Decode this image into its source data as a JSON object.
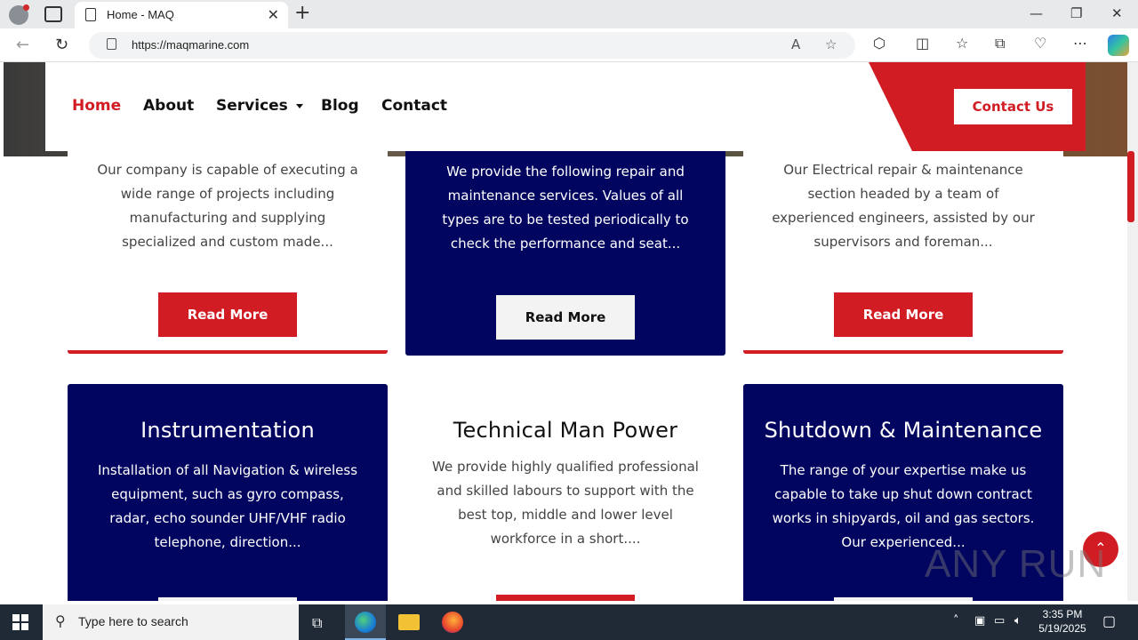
{
  "browser": {
    "tab_title": "Home - MAQ",
    "url": "https://maqmarine.com"
  },
  "nav": {
    "items": [
      "Home",
      "About",
      "Services",
      "Blog",
      "Contact"
    ],
    "cta": "Contact Us"
  },
  "cards_row1": [
    {
      "desc": "Our company is capable of executing a wide range of projects including manufacturing and supplying specialized and custom made...",
      "button": "Read More"
    },
    {
      "desc": "We provide the following repair and maintenance services. Values of all types are to be tested periodically to check the performance and seat...",
      "button": "Read More"
    },
    {
      "desc": "Our Electrical repair & maintenance section headed by a team of experienced engineers, assisted by our supervisors and foreman...",
      "button": "Read More"
    }
  ],
  "cards_row2": [
    {
      "title": "Instrumentation",
      "desc": "Installation of all Navigation & wireless equipment, such as gyro compass, radar, echo sounder UHF/VHF radio telephone, direction..."
    },
    {
      "title": "Technical Man Power",
      "desc": "We provide highly qualified professional and skilled labours to support with the best top, middle and lower level workforce in a short...."
    },
    {
      "title": "Shutdown & Maintenance",
      "desc": "The range of your expertise make us capable to take up shut down contract works in shipyards, oil and gas sectors. Our experienced..."
    }
  ],
  "watermark": "ANY RUN",
  "taskbar": {
    "search_placeholder": "Type here to search",
    "time": "3:35 PM",
    "date": "5/19/2025"
  },
  "colors": {
    "brand_red": "#d11c24",
    "navy": "#020560"
  }
}
